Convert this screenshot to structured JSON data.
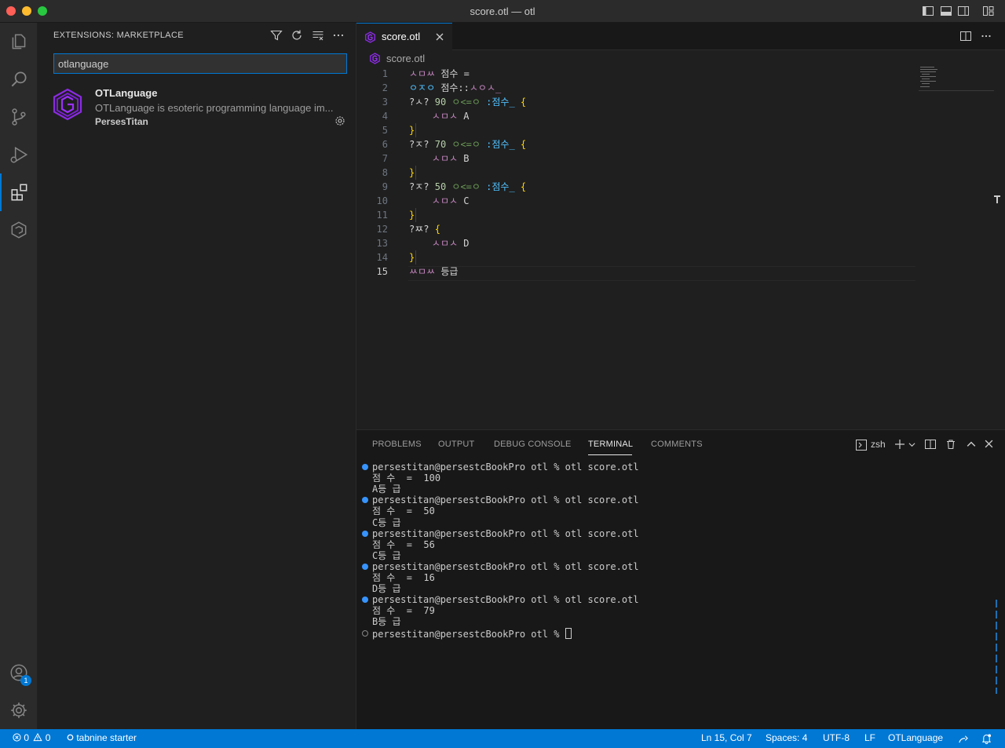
{
  "window": {
    "title": "score.otl — otl",
    "colors": {
      "close": "#ff5f57",
      "minimize": "#febc2e",
      "zoom": "#28c840",
      "accent": "#0078d4"
    }
  },
  "activity_bar": {
    "items": [
      "files-icon",
      "search-icon",
      "source-control-icon",
      "run-debug-icon",
      "extensions-icon",
      "otl-icon"
    ],
    "accounts_badge": "1"
  },
  "sidebar": {
    "title": "EXTENSIONS: MARKETPLACE",
    "search_value": "otlanguage",
    "extension": {
      "name": "OTLanguage",
      "description": "OTLanguage is esoteric programming language im...",
      "author": "PersesTitan"
    }
  },
  "editor": {
    "tab_label": "score.otl",
    "breadcrumb": "score.otl",
    "lines": [
      {
        "n": "1",
        "tokens": [
          {
            "t": "ㅅㅁㅆ",
            "c": "pink"
          },
          {
            "t": " 점수 =",
            "c": "white"
          }
        ]
      },
      {
        "n": "2",
        "tokens": [
          {
            "t": "ㅇㅈㅇ",
            "c": "blue"
          },
          {
            "t": " 점수::",
            "c": "white"
          },
          {
            "t": "ㅅㅇㅅ_",
            "c": "pink"
          }
        ]
      },
      {
        "n": "3",
        "tokens": [
          {
            "t": "?ㅅ? ",
            "c": "white"
          },
          {
            "t": "90",
            "c": "green"
          },
          {
            "t": " ",
            "c": "white"
          },
          {
            "t": "ㅇ<=ㅇ",
            "c": "lgreen"
          },
          {
            "t": " :점수_ ",
            "c": "blue"
          },
          {
            "t": "{",
            "c": "yellow"
          }
        ]
      },
      {
        "n": "4",
        "tokens": [
          {
            "t": "    ",
            "c": "white"
          },
          {
            "t": "ㅅㅁㅅ",
            "c": "pink"
          },
          {
            "t": " A",
            "c": "white"
          }
        ]
      },
      {
        "n": "5",
        "tokens": [
          {
            "t": "}",
            "c": "yellow"
          }
        ]
      },
      {
        "n": "6",
        "tokens": [
          {
            "t": "?ㅈ? ",
            "c": "white"
          },
          {
            "t": "70",
            "c": "green"
          },
          {
            "t": " ",
            "c": "white"
          },
          {
            "t": "ㅇ<=ㅇ",
            "c": "lgreen"
          },
          {
            "t": " :점수_ ",
            "c": "blue"
          },
          {
            "t": "{",
            "c": "yellow"
          }
        ]
      },
      {
        "n": "7",
        "tokens": [
          {
            "t": "    ",
            "c": "white"
          },
          {
            "t": "ㅅㅁㅅ",
            "c": "pink"
          },
          {
            "t": " B",
            "c": "white"
          }
        ]
      },
      {
        "n": "8",
        "tokens": [
          {
            "t": "}",
            "c": "yellow"
          }
        ]
      },
      {
        "n": "9",
        "tokens": [
          {
            "t": "?ㅈ? ",
            "c": "white"
          },
          {
            "t": "50",
            "c": "green"
          },
          {
            "t": " ",
            "c": "white"
          },
          {
            "t": "ㅇ<=ㅇ",
            "c": "lgreen"
          },
          {
            "t": " :점수_ ",
            "c": "blue"
          },
          {
            "t": "{",
            "c": "yellow"
          }
        ]
      },
      {
        "n": "10",
        "tokens": [
          {
            "t": "    ",
            "c": "white"
          },
          {
            "t": "ㅅㅁㅅ",
            "c": "pink"
          },
          {
            "t": " C",
            "c": "white"
          }
        ]
      },
      {
        "n": "11",
        "tokens": [
          {
            "t": "}",
            "c": "yellow"
          }
        ]
      },
      {
        "n": "12",
        "tokens": [
          {
            "t": "?ㅉ? ",
            "c": "white"
          },
          {
            "t": "{",
            "c": "yellow"
          }
        ]
      },
      {
        "n": "13",
        "tokens": [
          {
            "t": "    ",
            "c": "white"
          },
          {
            "t": "ㅅㅁㅅ",
            "c": "pink"
          },
          {
            "t": " D",
            "c": "white"
          }
        ]
      },
      {
        "n": "14",
        "tokens": [
          {
            "t": "}",
            "c": "yellow"
          }
        ]
      },
      {
        "n": "15",
        "tokens": [
          {
            "t": "ㅆㅁㅆ",
            "c": "pink"
          },
          {
            "t": " 등급",
            "c": "white"
          }
        ]
      }
    ]
  },
  "panel": {
    "tabs": [
      "PROBLEMS",
      "OUTPUT",
      "DEBUG CONSOLE",
      "TERMINAL",
      "COMMENTS"
    ],
    "active_tab": "TERMINAL",
    "shell": "zsh",
    "terminal_lines": [
      {
        "text": "persestitan@persestcBookPro otl % otl score.otl",
        "marker": "blue"
      },
      {
        "text": "점 수  =  100",
        "marker": ""
      },
      {
        "text": "A등 급",
        "marker": ""
      },
      {
        "text": "persestitan@persestcBookPro otl % otl score.otl",
        "marker": "blue"
      },
      {
        "text": "점 수  =  50",
        "marker": ""
      },
      {
        "text": "C등 급",
        "marker": ""
      },
      {
        "text": "persestitan@persestcBookPro otl % otl score.otl",
        "marker": "blue"
      },
      {
        "text": "점 수  =  56",
        "marker": ""
      },
      {
        "text": "C등 급",
        "marker": ""
      },
      {
        "text": "persestitan@persestcBookPro otl % otl score.otl",
        "marker": "blue"
      },
      {
        "text": "점 수  =  16",
        "marker": ""
      },
      {
        "text": "D등 급",
        "marker": ""
      },
      {
        "text": "persestitan@persestcBookPro otl % otl score.otl",
        "marker": "blue"
      },
      {
        "text": "점 수  =  79",
        "marker": ""
      },
      {
        "text": "B등 급",
        "marker": ""
      },
      {
        "text": "persestitan@persestcBookPro otl % ",
        "marker": "hollow"
      }
    ]
  },
  "status_bar": {
    "errors": "0",
    "warnings": "0",
    "tabnine": "tabnine starter",
    "position": "Ln 15, Col 7",
    "spaces": "Spaces: 4",
    "encoding": "UTF-8",
    "eol": "LF",
    "language": "OTLanguage"
  }
}
